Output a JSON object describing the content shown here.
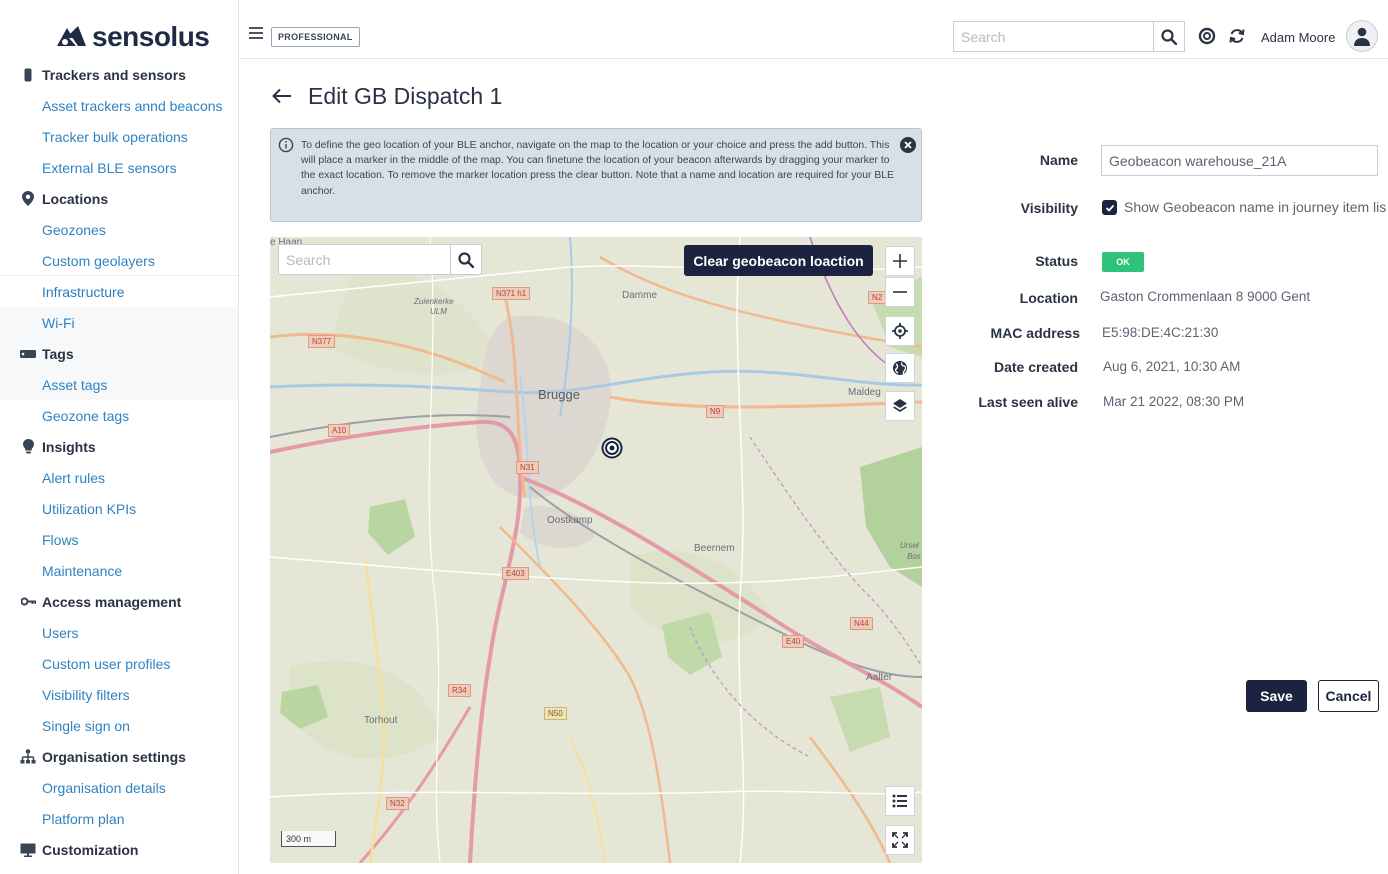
{
  "app": {
    "logo_text": "sensolus"
  },
  "topbar": {
    "plan_badge": "PROFESSIONAL",
    "search_placeholder": "Search",
    "user_name": "Adam Moore"
  },
  "sidebar": {
    "sections": [
      {
        "label": "Trackers and sensors",
        "icon": "tracker-icon",
        "items": [
          "Asset trackers annd beacons",
          "Tracker bulk operations",
          "External BLE sensors"
        ]
      },
      {
        "label": "Locations",
        "icon": "map-pin-icon",
        "items": [
          "Geozones",
          "Custom geolayers",
          "Infrastructure",
          "Wi-Fi"
        ]
      },
      {
        "label": "Tags",
        "icon": "tag-icon",
        "items": [
          "Asset tags",
          "Geozone tags"
        ]
      },
      {
        "label": "Insights",
        "icon": "lightbulb-icon",
        "items": [
          "Alert rules",
          "Utilization KPIs",
          "Flows",
          "Maintenance"
        ]
      },
      {
        "label": "Access management",
        "icon": "key-icon",
        "items": [
          "Users",
          "Custom user profiles",
          "Visibility filters",
          "Single sign on"
        ]
      },
      {
        "label": "Organisation settings",
        "icon": "org-chart-icon",
        "items": [
          "Organisation details",
          "Platform plan"
        ]
      },
      {
        "label": "Customization",
        "icon": "presentation-icon",
        "items": []
      }
    ],
    "active_item": "Infrastructure"
  },
  "page": {
    "title": "Edit GB Dispatch 1",
    "info": "To define the geo location of your BLE anchor, navigate on the map to the location or your choice and press the add button. This will place a marker in the middle of the map. You can finetune the location of your beacon afterwards by dragging your marker to the exact location. To remove the marker location press the clear button. Note that a name and location are required for your BLE anchor."
  },
  "map": {
    "search_placeholder": "Search",
    "clear_button": "Clear geobeacon loaction",
    "scale": "300 m",
    "labels": {
      "brugge": "Brugge",
      "damme": "Damme",
      "oostkamp": "Oostkamp",
      "beernem": "Beernem",
      "torhout": "Torhout",
      "aalter": "Aalter",
      "maldegem": "Maldeg",
      "zuienkerke": "Zuienkerke",
      "ulm": "ULM",
      "de_haan": "e Haan",
      "ursel": "Ursel",
      "bos": "Bos"
    },
    "roads": {
      "n371h1": "N371 h1",
      "n377": "N377",
      "a10": "A10",
      "n31": "N31",
      "n9": "N9",
      "e403": "E403",
      "e40": "E40",
      "n44": "N44",
      "r34": "R34",
      "n50": "N50",
      "n32": "N32",
      "n2": "N2"
    }
  },
  "details": {
    "name_label": "Name",
    "name_value": "Geobeacon warehouse_21A",
    "visibility_label": "Visibility",
    "visibility_text": "Show Geobeacon name in journey item lis",
    "visibility_checked": true,
    "status_label": "Status",
    "status_value": "OK",
    "status_color": "#2fc37a",
    "location_label": "Location",
    "location_value": "Gaston Crommenlaan 8 9000 Gent",
    "mac_label": "MAC address",
    "mac_value": "E5:98:DE:4C:21:30",
    "created_label": "Date created",
    "created_value": "Aug 6, 2021, 10:30 AM",
    "seen_label": "Last seen alive",
    "seen_value": "Mar 21 2022, 08:30 PM"
  },
  "actions": {
    "save": "Save",
    "cancel": "Cancel"
  },
  "colors": {
    "primary": "#1b2340",
    "link": "#2f83c3",
    "info_bg": "#d6e1e7"
  }
}
